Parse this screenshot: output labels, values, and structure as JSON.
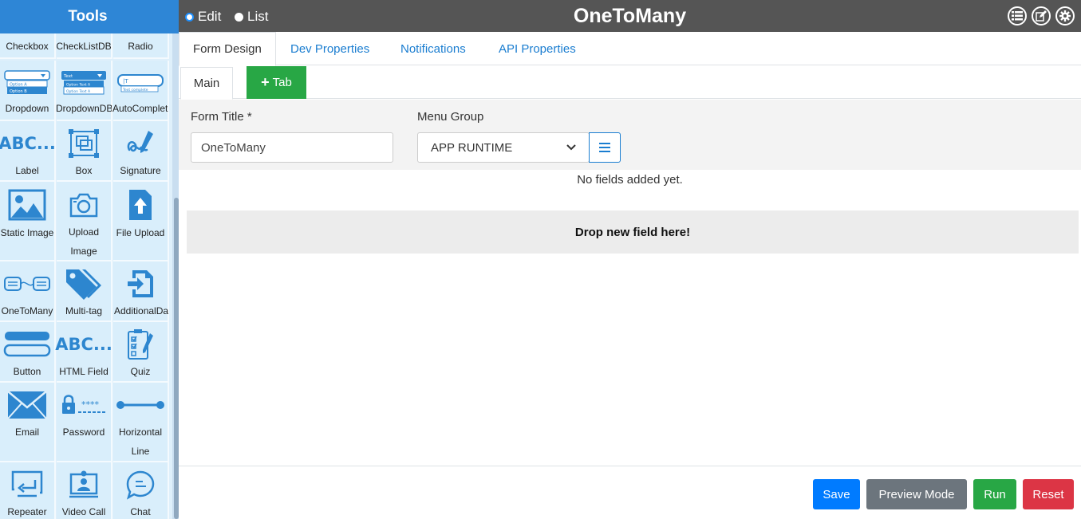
{
  "sidebar": {
    "title": "Tools",
    "tools": [
      {
        "label": "Checkbox",
        "icon": "checkbox-icon"
      },
      {
        "label": "CheckListDB",
        "icon": "checklist-db-icon"
      },
      {
        "label": "Radio",
        "icon": "radio-icon"
      },
      {
        "label": "Dropdown",
        "icon": "dropdown-icon"
      },
      {
        "label": "DropdownDB",
        "icon": "dropdown-db-icon"
      },
      {
        "label": "AutoComplete",
        "icon": "autocomplete-icon"
      },
      {
        "label": "Label",
        "icon": "label-icon"
      },
      {
        "label": "Box",
        "icon": "box-icon"
      },
      {
        "label": "Signature",
        "icon": "signature-icon"
      },
      {
        "label": "Static Image",
        "icon": "image-icon"
      },
      {
        "label": "Upload Image",
        "icon": "camera-icon"
      },
      {
        "label": "File Upload",
        "icon": "file-upload-icon"
      },
      {
        "label": "OneToMany",
        "icon": "one-to-many-icon"
      },
      {
        "label": "Multi-tag",
        "icon": "tags-icon"
      },
      {
        "label": "AdditionalData",
        "icon": "additional-data-icon"
      },
      {
        "label": "Button",
        "icon": "button-icon"
      },
      {
        "label": "HTML Field",
        "icon": "html-field-icon"
      },
      {
        "label": "Quiz",
        "icon": "quiz-icon"
      },
      {
        "label": "Email",
        "icon": "email-icon"
      },
      {
        "label": "Password",
        "icon": "password-icon"
      },
      {
        "label": "Horizontal Line",
        "icon": "horizontal-line-icon"
      },
      {
        "label": "Repeater",
        "icon": "repeater-icon"
      },
      {
        "label": "Video Call",
        "icon": "video-call-icon"
      },
      {
        "label": "Chat",
        "icon": "chat-icon"
      }
    ],
    "mini": {
      "dd_opt1": "Option A",
      "dd_opt2": "Option B",
      "ddb_text": "Text",
      "ddb_opt1": "Option Text A",
      "ddb_opt2": "Option Text A",
      "ac_cursor": "|T",
      "ac_text": "Text complete",
      "abc1": "ABC...",
      "abc2": "ABC...",
      "pw_mask": "****"
    }
  },
  "topbar": {
    "modes": [
      {
        "label": "Edit",
        "checked": true
      },
      {
        "label": "List",
        "checked": false
      }
    ],
    "title": "OneToMany",
    "icons": [
      "list-icon",
      "edit-icon",
      "gear-icon"
    ]
  },
  "tabs": [
    "Form Design",
    "Dev Properties",
    "Notifications",
    "API Properties"
  ],
  "subtabs": {
    "main": "Main",
    "add": "Tab"
  },
  "form": {
    "title_label": "Form Title *",
    "title_value": "OneToMany",
    "menu_label": "Menu Group",
    "menu_value": "APP RUNTIME"
  },
  "empty_message": "No fields added yet.",
  "dropzone": "Drop new field here!",
  "footer": {
    "save": "Save",
    "preview": "Preview Mode",
    "run": "Run",
    "reset": "Reset"
  },
  "colors": {
    "accent": "#2e86d6",
    "save": "#007bff",
    "preview": "#6c757d",
    "run": "#28a745",
    "reset": "#dc3545",
    "icon": "#2d86cf"
  }
}
